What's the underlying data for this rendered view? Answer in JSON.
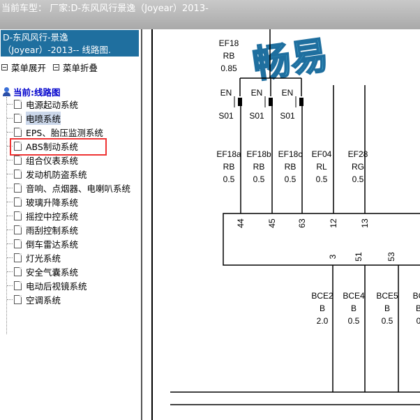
{
  "topbar": {
    "title": "当前车型： 厂家:D-东风风行景逸（Joyear）2013-"
  },
  "sidebar": {
    "header_line1": "D-东风风行-景逸",
    "header_line2": "（Joyear）-2013-- 线路图.",
    "expand_label": "菜单展开",
    "collapse_label": "菜单折叠",
    "root_label": "当前:线路图",
    "items": [
      {
        "label": "电源起动系统"
      },
      {
        "label": "电喷系统"
      },
      {
        "label": "EPS、胎压监测系统"
      },
      {
        "label": "ABS制动系统"
      },
      {
        "label": "组合仪表系统"
      },
      {
        "label": "发动机防盗系统"
      },
      {
        "label": "音响、点烟器、电喇叭系统"
      },
      {
        "label": "玻璃升降系统"
      },
      {
        "label": "摇控中控系统"
      },
      {
        "label": "雨刮控制系统"
      },
      {
        "label": "倒车雷达系统"
      },
      {
        "label": "灯光系统"
      },
      {
        "label": "安全气囊系统"
      },
      {
        "label": "电动后视镜系统"
      },
      {
        "label": "空调系统"
      }
    ],
    "selected_index": 1
  },
  "diagram": {
    "watermark": "畅易",
    "top_wire": {
      "name": "EF18",
      "color": "RB",
      "gauge": "0.85"
    },
    "splices": [
      {
        "top": "EN",
        "bottom": "S01"
      },
      {
        "top": "EN",
        "bottom": "S01"
      },
      {
        "top": "EN",
        "bottom": "S01"
      }
    ],
    "wires": [
      {
        "name": "EF18a",
        "color": "RB",
        "gauge": "0.5",
        "pin": "44"
      },
      {
        "name": "EF18b",
        "color": "RB",
        "gauge": "0.5",
        "pin": "45"
      },
      {
        "name": "EF18c",
        "color": "RB",
        "gauge": "0.5",
        "pin": "63"
      },
      {
        "name": "EF04",
        "color": "RL",
        "gauge": "0.5",
        "pin": "12"
      },
      {
        "name": "EF28",
        "color": "RG",
        "gauge": "0.5",
        "pin": "13"
      }
    ],
    "bottom_pins": [
      "3",
      "51",
      "53"
    ],
    "bottom_wires": [
      {
        "name": "BCE2",
        "color": "B",
        "gauge": "2.0"
      },
      {
        "name": "BCE4",
        "color": "B",
        "gauge": "0.5"
      },
      {
        "name": "BCE5",
        "color": "B",
        "gauge": "0.5"
      },
      {
        "name": "BC",
        "color": "B",
        "gauge": "0"
      }
    ]
  }
}
